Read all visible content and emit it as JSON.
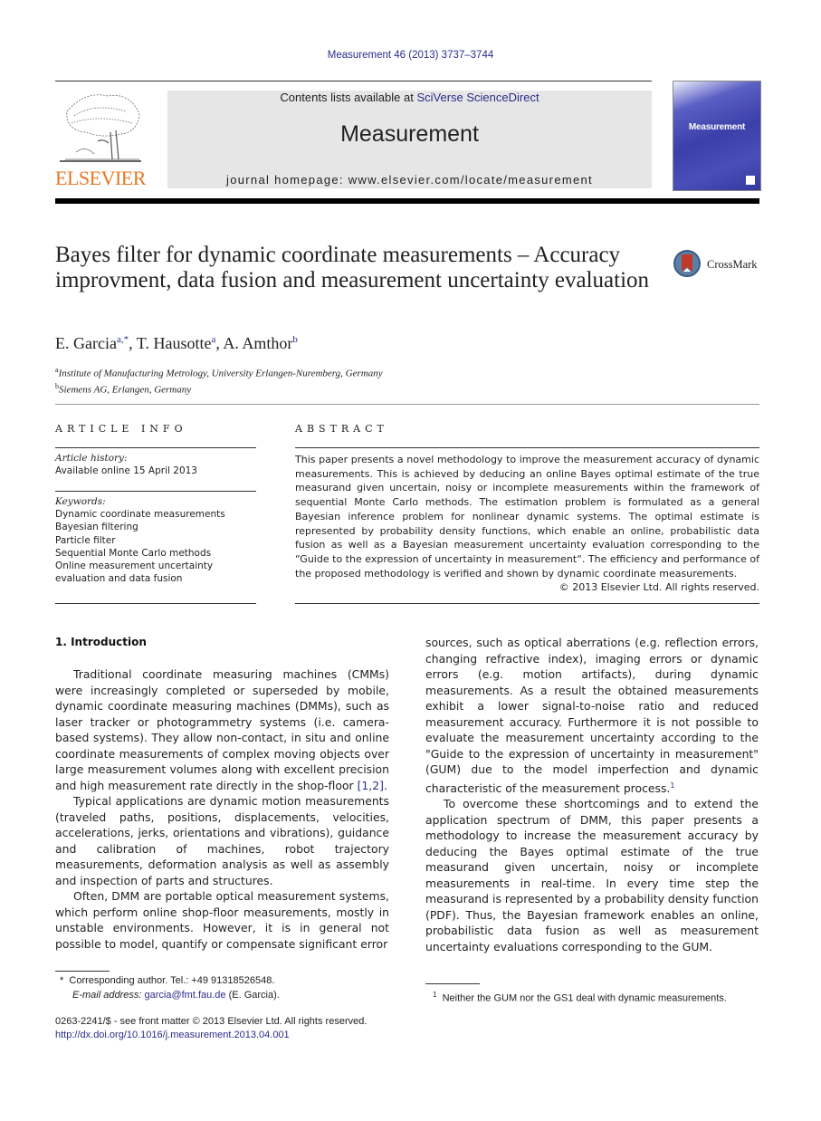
{
  "header": {
    "citation": "Measurement 46 (2013) 3737–3744",
    "contents_prefix": "Contents lists available at ",
    "contents_link": "SciVerse ScienceDirect",
    "journal_name": "Measurement",
    "homepage": "journal homepage: www.elsevier.com/locate/measurement",
    "publisher_logo_text": "ELSEVIER",
    "cover_title": "Measurement"
  },
  "article": {
    "title": "Bayes filter for dynamic coordinate measurements – Accuracy improvment, data fusion and measurement uncertainty evaluation",
    "crossmark_label": "CrossMark",
    "authors": [
      {
        "name": "E. Garcia",
        "sup": "a,*"
      },
      {
        "name": "T. Hausotte",
        "sup": "a"
      },
      {
        "name": "A. Amthor",
        "sup": "b"
      }
    ],
    "affiliations": [
      {
        "sup": "a",
        "text": "Institute of Manufacturing Metrology, University Erlangen-Nuremberg, Germany"
      },
      {
        "sup": "b",
        "text": "Siemens AG, Erlangen, Germany"
      }
    ]
  },
  "article_info": {
    "heading": "ARTICLE INFO",
    "history_label": "Article history:",
    "history_value": "Available online 15 April 2013",
    "keywords_label": "Keywords:",
    "keywords": [
      "Dynamic coordinate measurements",
      "Bayesian filtering",
      "Particle filter",
      "Sequential Monte Carlo methods",
      "Online measurement uncertainty evaluation and data fusion"
    ]
  },
  "abstract": {
    "heading": "ABSTRACT",
    "text": "This paper presents a novel methodology to improve the measurement accuracy of dynamic measurements. This is achieved by deducing an online Bayes optimal estimate of the true measurand given uncertain, noisy or incomplete measurements within the framework of sequential Monte Carlo methods. The estimation problem is formulated as a general Bayesian inference problem for nonlinear dynamic systems. The optimal estimate is represented by probability density functions, which enable an online, probabilistic data fusion as well as a Bayesian measurement uncertainty evaluation corresponding to the “Guide to the expression of uncertainty in measurement“. The efficiency and performance of the proposed methodology is verified and shown by dynamic coordinate measurements.",
    "copyright": "© 2013 Elsevier Ltd. All rights reserved."
  },
  "body": {
    "section_heading": "1. Introduction",
    "left_paragraphs": [
      {
        "text": "Traditional coordinate measuring machines (CMMs) were increasingly completed or superseded by mobile, dynamic coordinate measuring machines (DMMs), such as laser tracker or photogrammetry systems (i.e. camera-based systems). They allow non-contact, in situ and online coordinate measurements of complex moving objects over large measurement volumes along with excellent precision and high measurement rate directly in the shop-floor ",
        "ref": "[1,2]",
        "tail": "."
      },
      {
        "text": "Typical applications are dynamic motion measurements (traveled paths, positions, displacements, velocities, accelerations, jerks, orientations and vibrations), guidance and calibration of machines, robot trajectory measurements, deformation analysis as well as assembly and inspection of parts and structures."
      },
      {
        "text": "Often, DMM are portable optical measurement systems, which perform online shop-floor measurements, mostly in unstable environments. However, it is in general not possible to model, quantify or compensate significant error"
      }
    ],
    "right_paragraphs": [
      {
        "text": "sources, such as optical aberrations (e.g. reflection errors, changing refractive index), imaging errors or dynamic errors (e.g. motion artifacts), during dynamic measurements. As a result the obtained measurements exhibit a lower signal-to-noise ratio and reduced measurement accuracy. Furthermore it is not possible to evaluate the measurement uncertainty according to the \"Guide to the expression of uncertainty in measurement\" (GUM) due to the model imperfection and dynamic characteristic of the measurement process.",
        "footnote_ref": "1"
      },
      {
        "text": "To overcome these shortcomings and to extend the application spectrum of DMM, this paper presents a methodology to increase the measurement accuracy by deducing the Bayes optimal estimate of the true measurand given uncertain, noisy or incomplete measurements in real-time. In every time step the measurand is represented by a probability density function (PDF). Thus, the Bayesian framework enables an online, probabilistic data fusion as well as measurement uncertainty evaluations corresponding to the GUM."
      }
    ]
  },
  "footnotes": {
    "corresponding": "Corresponding author. Tel.: +49 91318526548.",
    "corresponding_mark": "*",
    "email_label": "E-mail address:",
    "email": "garcia@fmt.fau.de",
    "email_suffix": " (E. Garcia).",
    "fn1_mark": "1",
    "fn1_text": "Neither the GUM nor the GS1 deal with dynamic measurements.",
    "front_matter": "0263-2241/$ - see front matter © 2013 Elsevier Ltd. All rights reserved.",
    "doi": "http://dx.doi.org/10.1016/j.measurement.2013.04.001"
  },
  "colors": {
    "link": "#2c2c8a",
    "elsevier_orange": "#e87722",
    "banner_bg": "#e6e6e6"
  }
}
